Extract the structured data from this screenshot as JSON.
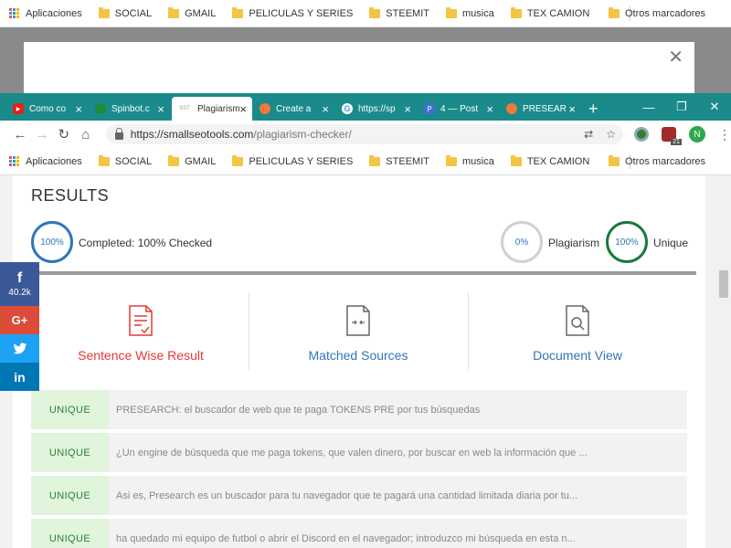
{
  "bookmarks": {
    "apps_label": "Aplicaciones",
    "items": [
      "SOCIAL",
      "GMAIL",
      "PELICULAS Y SERIES",
      "STEEMIT",
      "musica",
      "TEX CAMION"
    ],
    "other": "Otros marcadores"
  },
  "tabs": [
    {
      "label": "Como co",
      "fav_color": "#e62117"
    },
    {
      "label": "Spinbot.c",
      "fav_color": "#1c8c3c"
    },
    {
      "label": "Plagiarism",
      "fav_color": "#ffffff",
      "fav_text": "SST",
      "active": true
    },
    {
      "label": "Create a",
      "fav_color": "#f07a3c"
    },
    {
      "label": "https://sp",
      "fav_color": "#4a8af4"
    },
    {
      "label": "4 — Post",
      "fav_color": "#3f6fd0"
    },
    {
      "label": "PRESEAR",
      "fav_color": "#f07a3c"
    }
  ],
  "address": {
    "scheme_host": "https://smallseotools.com",
    "path": "/plagiarism-checker/",
    "profile_initial": "N",
    "ext_badge": "21"
  },
  "results": {
    "title": "RESULTS",
    "completed_pct": "100%",
    "completed_label": "Completed: 100% Checked",
    "plagiarism_pct": "0%",
    "plagiarism_label": "Plagiarism",
    "unique_pct": "100%",
    "unique_label": "Unique"
  },
  "views": {
    "sentence": "Sentence Wise Result",
    "matched": "Matched Sources",
    "document": "Document View"
  },
  "rows": [
    {
      "tag": "UNIQUE",
      "text": "PRESEARCH: el buscador de web que te paga TOKENS PRE por tus búsquedas"
    },
    {
      "tag": "UNIQUE",
      "text": "¿Un engine de búsqueda que me paga tokens, que valen dinero, por buscar en web la información que ..."
    },
    {
      "tag": "UNIQUE",
      "text": "Asi es, Presearch es un buscador para tu navegador que te pagará una cantidad limitada diaria por tu..."
    },
    {
      "tag": "UNIQUE",
      "text": "ha quedado mi equipo de futbol o abrir el Discord en el navegador; introduzco mi búsqueda en esta n..."
    }
  ],
  "social": {
    "facebook_count": "40.2k",
    "colors": {
      "facebook": "#3b5998",
      "google": "#dd4b39",
      "twitter": "#1da1f2",
      "linkedin": "#0077b5"
    }
  },
  "colors": {
    "tab_bg": "#1a8a8a",
    "blue": "#2f76b8",
    "red": "#e53935",
    "green": "#167a3b"
  }
}
